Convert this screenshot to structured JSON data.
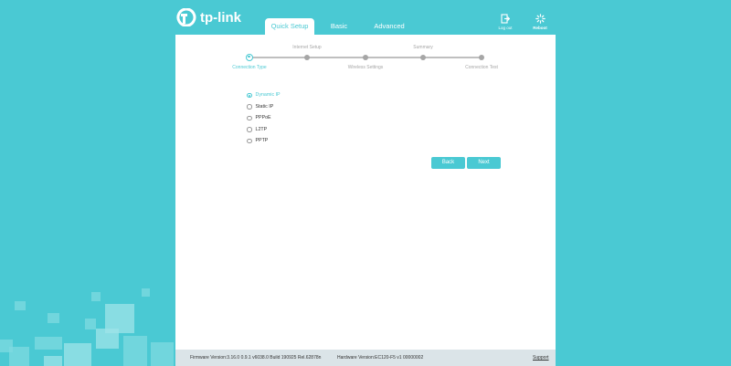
{
  "brand": {
    "logo_text": "tp-link"
  },
  "nav": {
    "tabs": [
      {
        "label": "Quick Setup",
        "active": true
      },
      {
        "label": "Basic",
        "active": false
      },
      {
        "label": "Advanced",
        "active": false
      }
    ],
    "logout_label": "Log out",
    "reboot_label": "Reboot"
  },
  "wizard": {
    "steps": [
      {
        "label": "Connection Type",
        "active": true
      },
      {
        "label": "Internet Setup",
        "active": false
      },
      {
        "label": "Wireless Settings",
        "active": false
      },
      {
        "label": "Summary",
        "active": false
      },
      {
        "label": "Connection Test",
        "active": false
      }
    ],
    "connection_types": [
      {
        "label": "Dynamic IP",
        "selected": true
      },
      {
        "label": "Static IP",
        "selected": false
      },
      {
        "label": "PPPoE",
        "selected": false
      },
      {
        "label": "L2TP",
        "selected": false
      },
      {
        "label": "PPTP",
        "selected": false
      }
    ],
    "back_label": "Back",
    "next_label": "Next"
  },
  "footer": {
    "firmware": "Firmware Version:3.16.0 0.9.1 v6038.0 Build 190925 Rel.62878n",
    "hardware": "Hardware Version:EC120-F5 v1 00000002",
    "support_label": "Support"
  },
  "colors": {
    "accent": "#4ac9d3",
    "background": "#4ac9d3",
    "footer": "#dbe4e8"
  },
  "icons": {
    "logout": "logout-icon",
    "reboot": "reboot-icon",
    "logo": "tp-link-logo-icon"
  }
}
